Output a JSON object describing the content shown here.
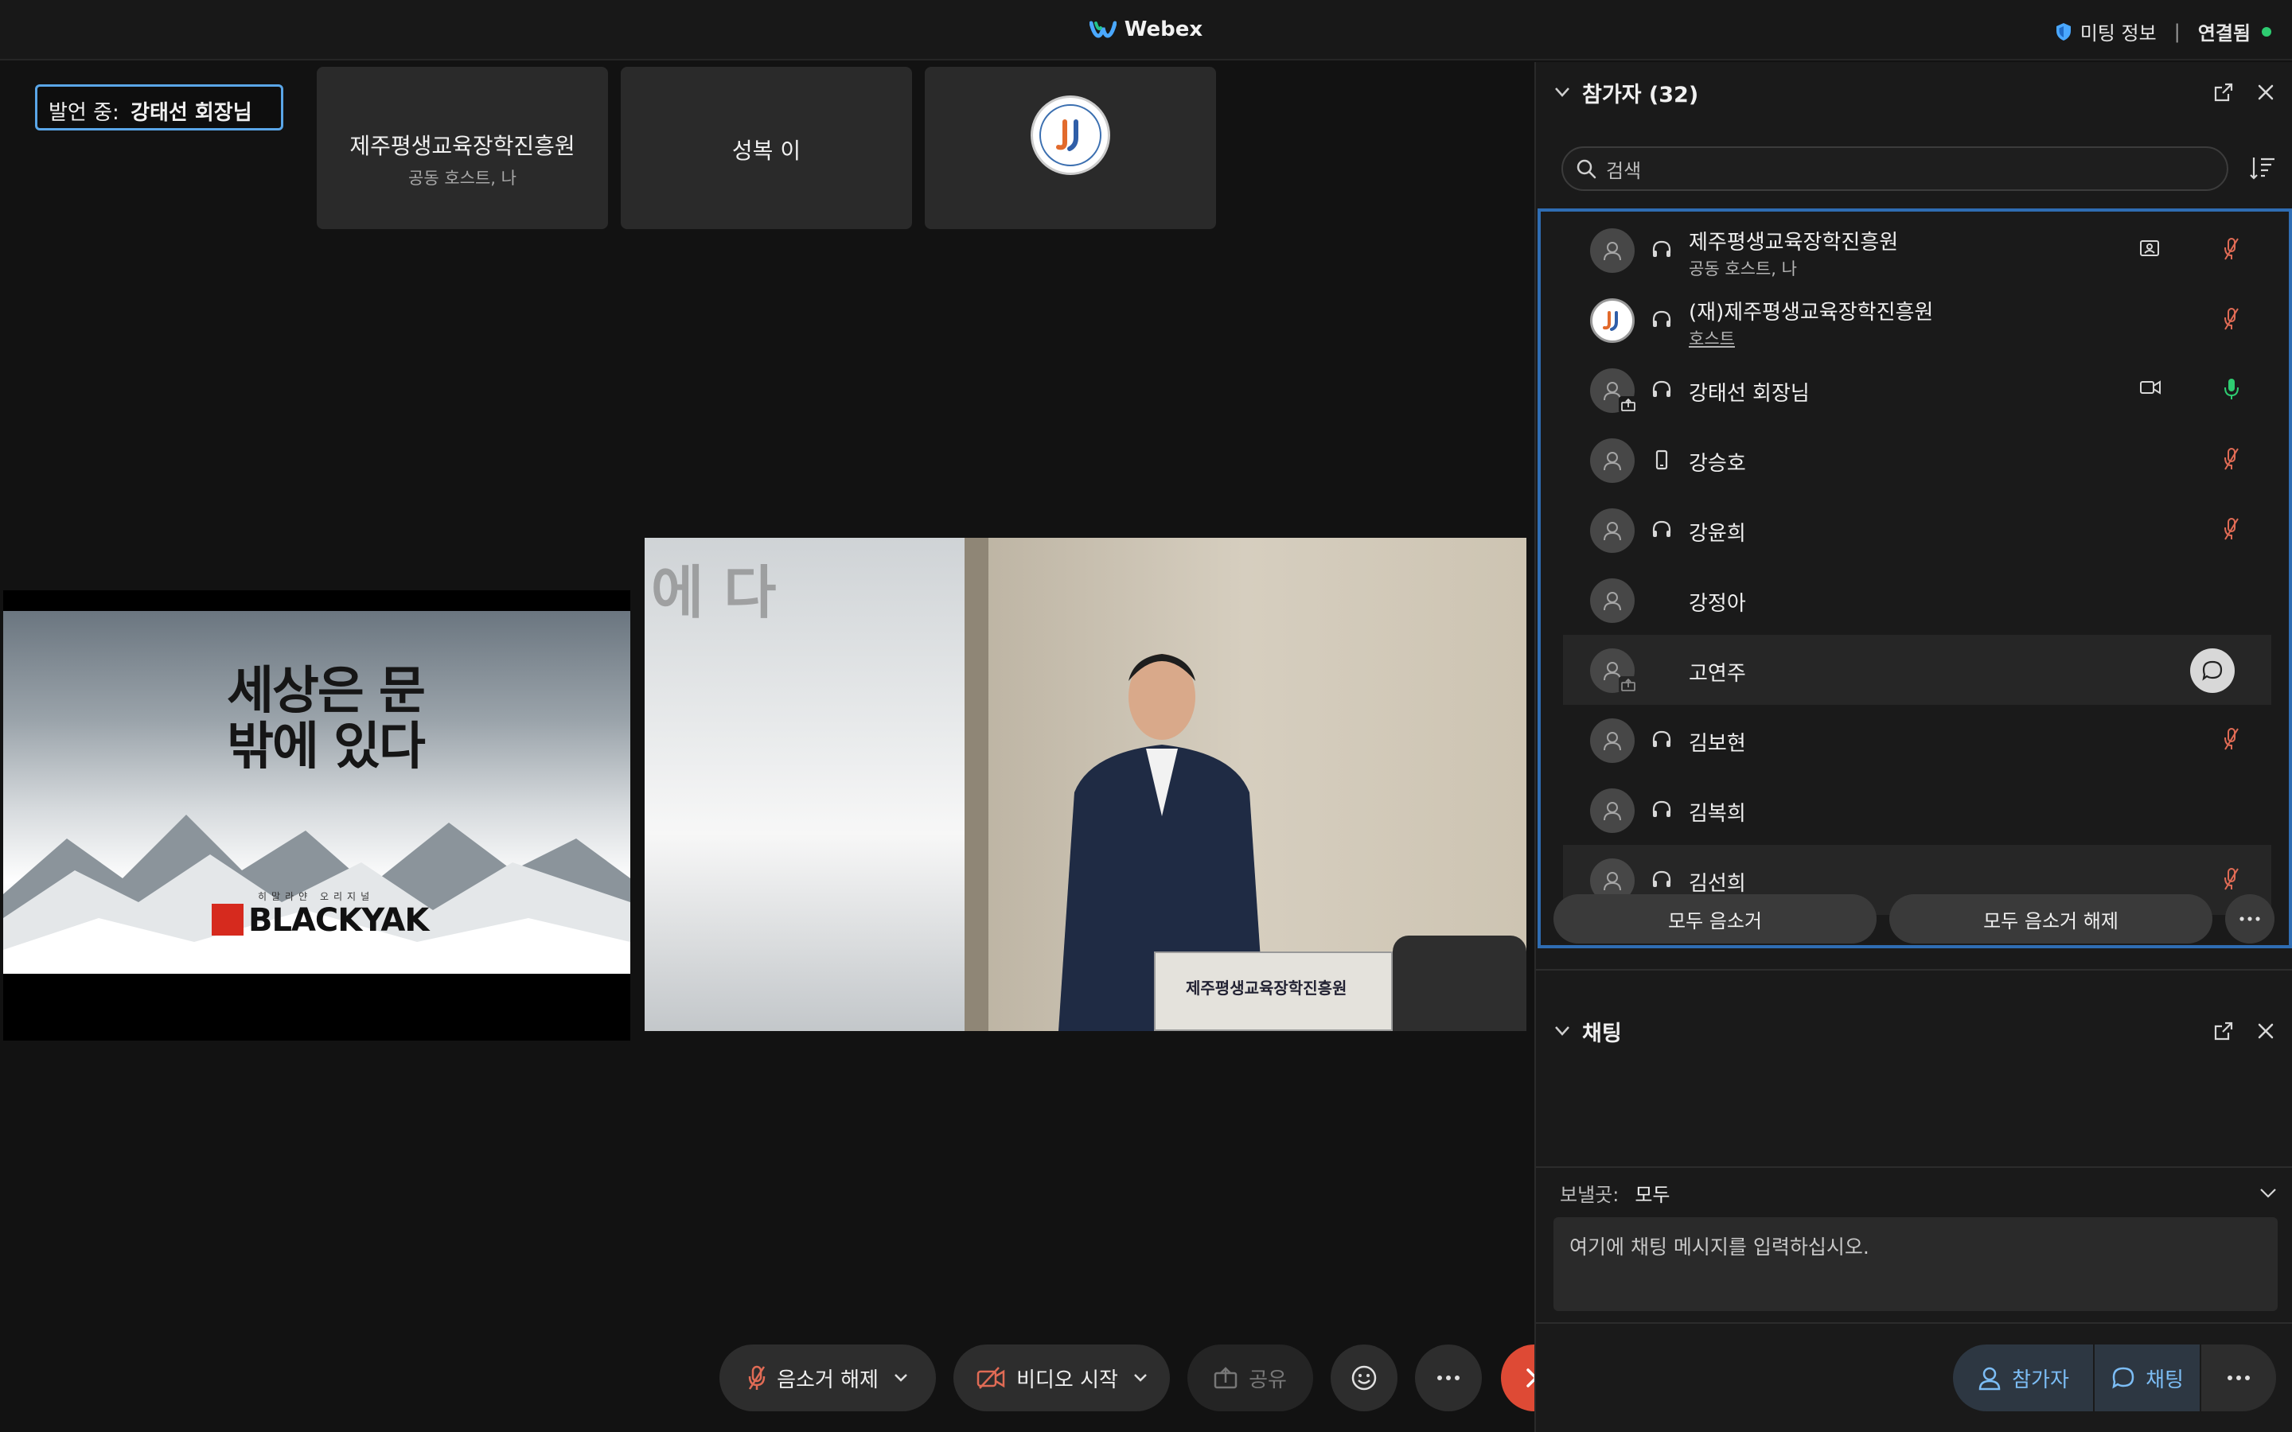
{
  "titlebar": {
    "app_name": "Webex",
    "meeting_info": "미팅 정보",
    "separator": "|",
    "status": "연결됨",
    "status_color": "#2ecc71"
  },
  "stage": {
    "speaking_prefix": "발언 중:",
    "speaking_name": "강태선 회장님",
    "thumbnails": [
      {
        "name": "제주평생교육장학진흥원",
        "sub": "공동 호스트, 나"
      },
      {
        "name": "성복 이"
      },
      {
        "name": "",
        "icon": "org-logo"
      }
    ],
    "video_left": {
      "headline": "세상은 문 밖에 있다",
      "tagline": "히말라얀 오리지널",
      "brand": "BLACKYAK"
    },
    "video_main": {
      "desk_label": "제주평생교육장학진흥원",
      "screen_text": "에 다"
    }
  },
  "controls": {
    "unmute": "음소거 해제",
    "start_video": "비디오 시작",
    "share": "공유",
    "participants": "참가자",
    "chat": "채팅",
    "end_color": "#de4a35"
  },
  "participants_panel": {
    "title": "참가자 (32)",
    "search_placeholder": "검색",
    "items": [
      {
        "name": "제주평생교육장학진흥원",
        "sub": "공동 호스트, 나",
        "audio": "headset",
        "extra": "presenter-icon",
        "mic": "muted"
      },
      {
        "name": "(재)제주평생교육장학진흥원",
        "sub": "호스트",
        "audio": "headset",
        "mic": "muted",
        "avatar": "org-logo"
      },
      {
        "name": "강태선 회장님",
        "audio": "headset",
        "extra": "video-icon",
        "mic": "active",
        "sharing": true
      },
      {
        "name": "강승호",
        "audio": "phone",
        "mic": "muted"
      },
      {
        "name": "강윤희",
        "audio": "headset",
        "mic": "muted"
      },
      {
        "name": "강정아"
      },
      {
        "name": "고연주",
        "sharing": true,
        "chat_bubble": true
      },
      {
        "name": "김보현",
        "audio": "headset",
        "mic": "muted"
      },
      {
        "name": "김복희",
        "audio": "headset"
      },
      {
        "name": "김선희",
        "audio": "headset",
        "mic": "muted"
      }
    ],
    "mute_all": "모두 음소거",
    "unmute_all": "모두 음소거 해제"
  },
  "chat_panel": {
    "title": "채팅",
    "send_to_label": "보낼곳:",
    "send_to_value": "모두",
    "input_placeholder": "여기에 채팅 메시지를 입력하십시오."
  }
}
